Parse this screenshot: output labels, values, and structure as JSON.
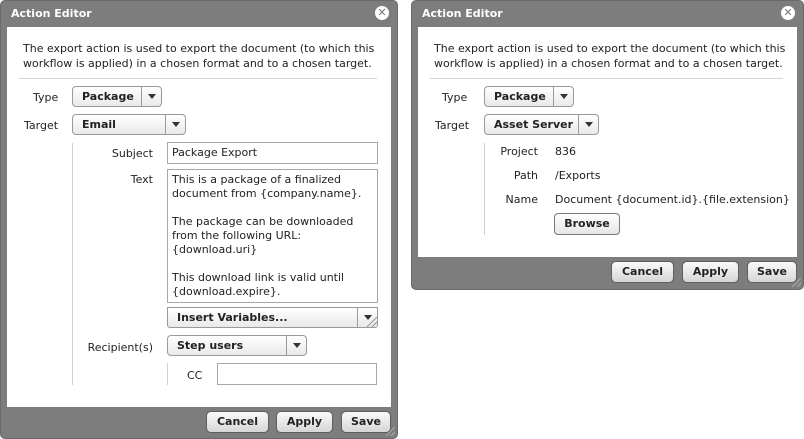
{
  "left": {
    "title": "Action Editor",
    "description": "The export action is used to export the document (to which this workflow is applied) in a chosen format and to a chosen target.",
    "type_label": "Type",
    "type_value": "Package",
    "target_label": "Target",
    "target_value": "Email",
    "subject_label": "Subject",
    "subject_value": "Package Export",
    "text_label": "Text",
    "text_lines": [
      "This is a package of a finalized document from {company.name}.",
      "The package can be downloaded from the following URL: {download.uri}",
      "This download link is valid until {download.expire}."
    ],
    "insert_variables": "Insert Variables...",
    "recipients_label": "Recipient(s)",
    "recipients_value": "Step users",
    "cc_label": "CC",
    "cc_value": "",
    "buttons": {
      "cancel": "Cancel",
      "apply": "Apply",
      "save": "Save"
    }
  },
  "right": {
    "title": "Action Editor",
    "description": "The export action is used to export the document (to which this workflow is applied) in a chosen format and to a chosen target.",
    "type_label": "Type",
    "type_value": "Package",
    "target_label": "Target",
    "target_value": "Asset Server",
    "project_label": "Project",
    "project_value": "836",
    "path_label": "Path",
    "path_value": "/Exports",
    "name_label": "Name",
    "name_value": "Document {document.id}.{file.extension}",
    "browse": "Browse",
    "buttons": {
      "cancel": "Cancel",
      "apply": "Apply",
      "save": "Save"
    }
  }
}
